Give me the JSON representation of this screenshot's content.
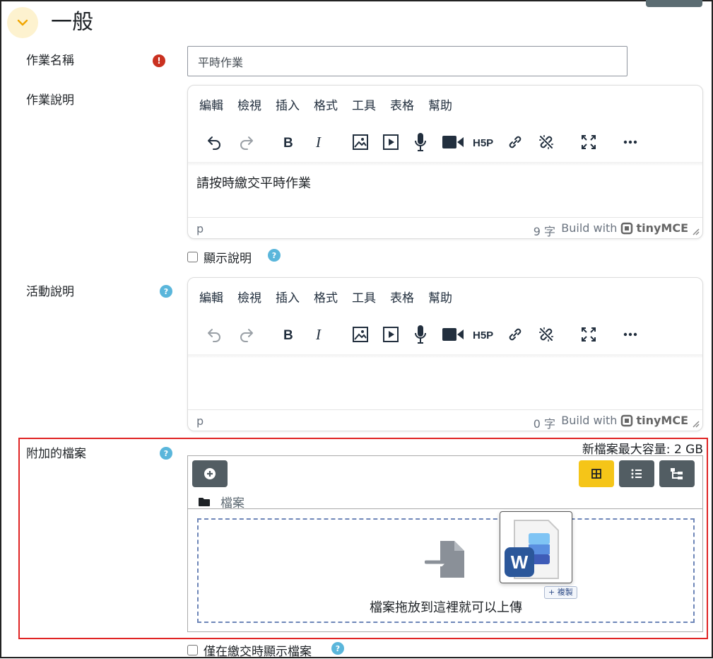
{
  "section": {
    "title": "一般"
  },
  "assignment_name": {
    "label": "作業名稱",
    "value": "平時作業"
  },
  "editor_menu": [
    "編輯",
    "檢視",
    "插入",
    "格式",
    "工具",
    "表格",
    "幫助"
  ],
  "description": {
    "label": "作業說明",
    "content": "請按時繳交平時作業",
    "status_path": "p",
    "word_count": "9 字",
    "brand_prefix": "Build with",
    "brand_name": "tinyMCE",
    "show_label": "顯示說明"
  },
  "activity": {
    "label": "活動說明",
    "status_path": "p",
    "word_count": "0 字",
    "brand_prefix": "Build with",
    "brand_name": "tinyMCE"
  },
  "attachments": {
    "label": "附加的檔案",
    "max_size": "新檔案最大容量: 2 GB",
    "folder_label": "檔案",
    "dropzone_text": "檔案拖放到這裡就可以上傳",
    "copy_badge": "+ 複製",
    "drag_file_letter": "W",
    "show_only_on_submit": "僅在繳交時顯示檔案"
  },
  "colors": {
    "required": "#ca3120",
    "help": "#5ab6db",
    "active_view": "#f5c518",
    "button_dark": "#525d63",
    "highlight": "#e02424"
  },
  "icons": {
    "toolbar": [
      "undo-icon",
      "redo-icon",
      "bold-icon",
      "italic-icon",
      "image-icon",
      "media-icon",
      "microphone-icon",
      "video-icon",
      "h5p-icon",
      "link-icon",
      "unlink-icon",
      "fullscreen-icon",
      "more-icon"
    ],
    "views": [
      "grid-view-icon",
      "list-view-icon",
      "tree-view-icon"
    ]
  }
}
